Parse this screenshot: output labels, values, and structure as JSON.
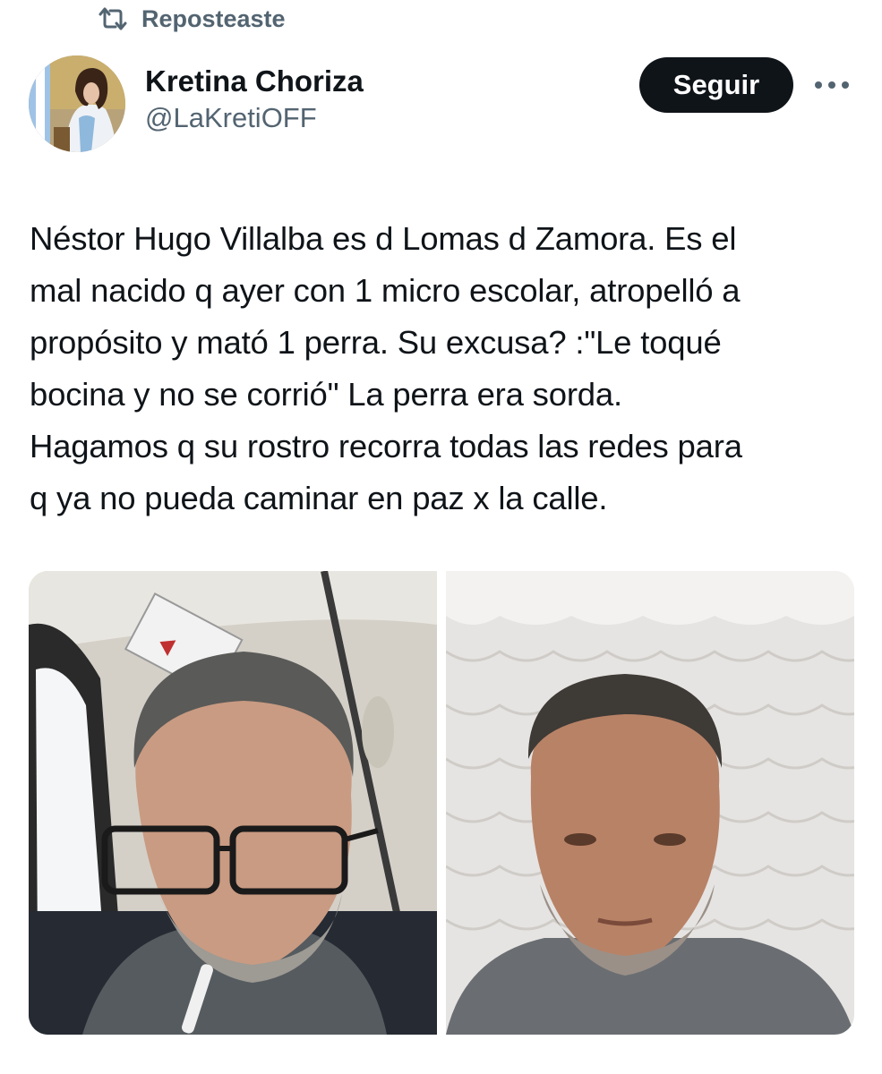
{
  "repost": {
    "icon": "repost-icon",
    "label": "Reposteaste"
  },
  "author": {
    "avatar": "author-avatar",
    "name": "Kretina Choriza",
    "handle": "@LaKretiOFF"
  },
  "actions": {
    "follow_label": "Seguir",
    "more_icon": "more-options-icon"
  },
  "tweet": {
    "text": "Néstor Hugo Villalba es d Lomas d Zamora. Es el\nmal nacido q ayer con 1 micro escolar, atropelló a\npropósito y mató 1 perra. Su excusa? :\"Le toqué\nbocina y no se corrió\" La perra era sorda.\nHagamos q su rostro recorra todas las redes para\nq ya no pueda caminar en paz x la calle."
  },
  "media": [
    {
      "name": "photo-man-in-bus"
    },
    {
      "name": "photo-man-with-curtain"
    }
  ],
  "colors": {
    "text_primary": "#0f1419",
    "text_secondary": "#536471",
    "follow_bg": "#0f1419",
    "follow_text": "#ffffff"
  }
}
